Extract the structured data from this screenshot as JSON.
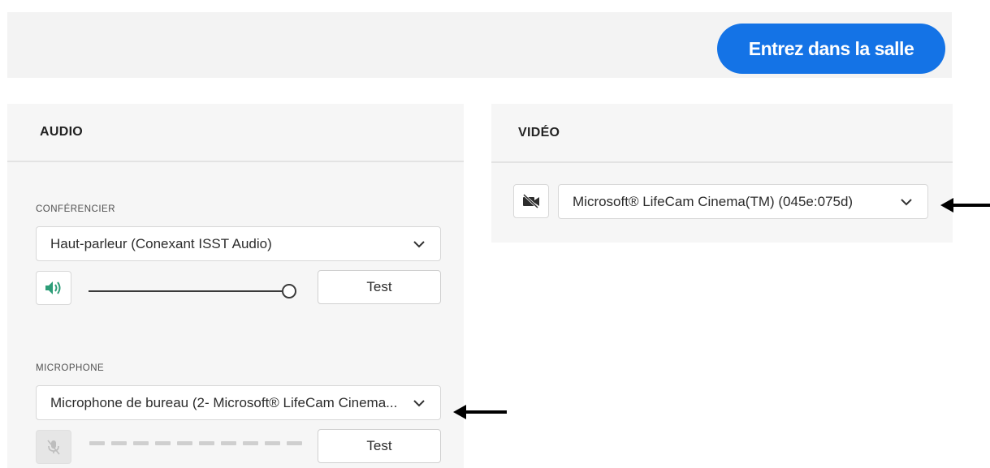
{
  "header": {
    "enter_label": "Entrez dans la salle"
  },
  "audio": {
    "title": "AUDIO",
    "speaker": {
      "label": "CONFÉRENCIER",
      "selected": "Haut-parleur (Conexant ISST Audio)",
      "volume_percent": 100,
      "test_label": "Test",
      "icon": "speaker-volume-icon"
    },
    "microphone": {
      "label": "MICROPHONE",
      "selected": "Microphone de bureau (2- Microsoft® LifeCam Cinema...",
      "test_label": "Test",
      "icon": "microphone-off-icon",
      "meter_segments": 10
    }
  },
  "video": {
    "title": "VIDÉO",
    "camera": {
      "selected": "Microsoft® LifeCam Cinema(TM) (045e:075d)",
      "icon": "camera-off-icon"
    }
  },
  "colors": {
    "accent": "#1473e6",
    "speaker_icon": "#2d9d78",
    "panel_bg": "#f6f6f6",
    "topbar_bg": "#f3f3f3"
  }
}
